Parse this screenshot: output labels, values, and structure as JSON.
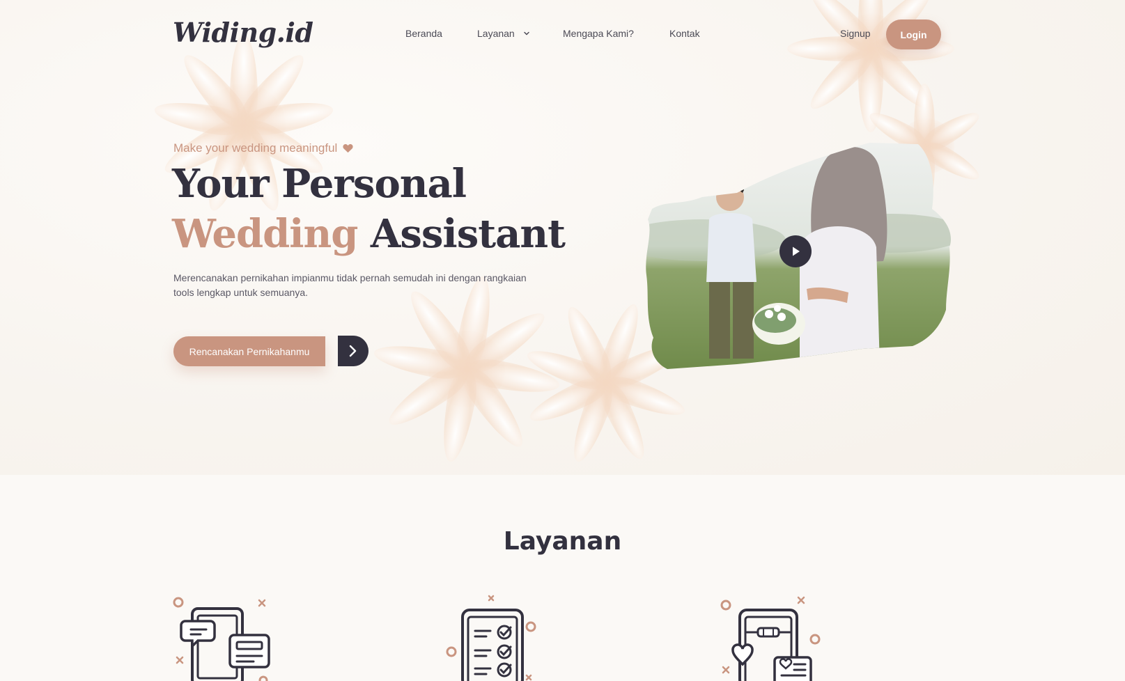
{
  "brand": {
    "logo_text": "Widing.id"
  },
  "nav": {
    "items": [
      {
        "label": "Beranda"
      },
      {
        "label": "Layanan"
      },
      {
        "label": "Mengapa Kami?"
      },
      {
        "label": "Kontak"
      }
    ],
    "signup_label": "Signup",
    "login_label": "Login"
  },
  "hero": {
    "tagline": "Make your wedding meaningful",
    "headline_line1": "Your Personal",
    "headline_accent": "Wedding",
    "headline_rest": "Assistant",
    "subtext": "Merencanakan pernikahan impianmu tidak pernah semudah ini dengan rangkaian tools lengkap untuk semuanya.",
    "cta_label": "Rencanakan Pernikahanmu"
  },
  "services": {
    "title": "Layanan",
    "icons": [
      "chat-tablet-icon",
      "checklist-icon",
      "invitation-phone-icon"
    ]
  },
  "colors": {
    "accent": "#c99580",
    "dark": "#33313f",
    "background": "#fbf9f6"
  }
}
